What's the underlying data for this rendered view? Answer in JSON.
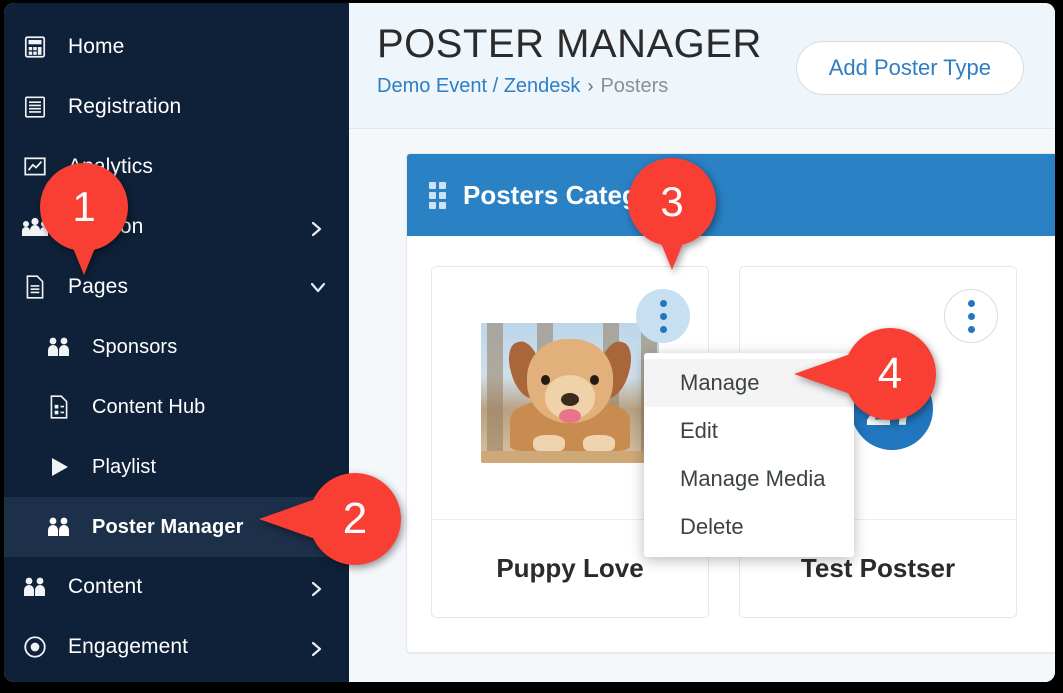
{
  "sidebar": {
    "items": [
      {
        "label": "Home",
        "icon": "calculator-icon",
        "level": "top",
        "chevron": "",
        "active": false
      },
      {
        "label": "Registration",
        "icon": "form-list-icon",
        "level": "top",
        "chevron": "",
        "active": false
      },
      {
        "label": "Analytics",
        "icon": "chart-line-icon",
        "level": "top",
        "chevron": "",
        "active": false
      },
      {
        "label": "Session",
        "icon": "people-group-icon",
        "level": "top",
        "chevron": "chevron-right-icon",
        "active": false
      },
      {
        "label": "Pages",
        "icon": "document-icon",
        "level": "top",
        "chevron": "chevron-down-icon",
        "active": false
      },
      {
        "label": "Sponsors",
        "icon": "two-people-icon",
        "level": "sub",
        "chevron": "",
        "active": false
      },
      {
        "label": "Content Hub",
        "icon": "content-doc-icon",
        "level": "sub",
        "chevron": "",
        "active": false
      },
      {
        "label": "Playlist",
        "icon": "play-triangle-icon",
        "level": "sub",
        "chevron": "",
        "active": false
      },
      {
        "label": "Poster Manager",
        "icon": "two-people-icon",
        "level": "sub",
        "chevron": "",
        "active": true
      },
      {
        "label": "Content",
        "icon": "two-people-icon",
        "level": "top",
        "chevron": "chevron-right-icon",
        "active": false
      },
      {
        "label": "Engagement",
        "icon": "target-circle-icon",
        "level": "top",
        "chevron": "chevron-right-icon",
        "active": false
      }
    ]
  },
  "header": {
    "title": "POSTER MANAGER",
    "breadcrumb": {
      "link": "Demo Event / Zendesk",
      "separator": "›",
      "current": "Posters"
    },
    "add_button": "Add Poster Type"
  },
  "panel": {
    "title": "Posters Category",
    "drag_handle_icon": "drag-grip-icon",
    "cards": [
      {
        "name": "Puppy Love",
        "media": "puppy-photo",
        "menu_icon": "kebab-menu-icon",
        "menu_style": "filled"
      },
      {
        "name": "Test Postser",
        "media": "blue-circle-logo",
        "media_label": "27",
        "menu_icon": "kebab-menu-icon",
        "menu_style": "outline"
      }
    ]
  },
  "dropdown": {
    "items": [
      {
        "label": "Manage",
        "hovered": true
      },
      {
        "label": "Edit",
        "hovered": false
      },
      {
        "label": "Manage Media",
        "hovered": false
      },
      {
        "label": "Delete",
        "hovered": false
      }
    ]
  },
  "callouts": [
    {
      "number": "1",
      "shape": "pin-down"
    },
    {
      "number": "2",
      "shape": "pin-left"
    },
    {
      "number": "3",
      "shape": "pin-down"
    },
    {
      "number": "4",
      "shape": "pin-left"
    }
  ],
  "colors": {
    "sidebar_bg": "#0f2138",
    "sidebar_active": "#1d3049",
    "accent_blue": "#2a81c4",
    "link_blue": "#2e7ec4",
    "callout_red": "#f93f33",
    "page_bg": "#f4f8fb"
  }
}
